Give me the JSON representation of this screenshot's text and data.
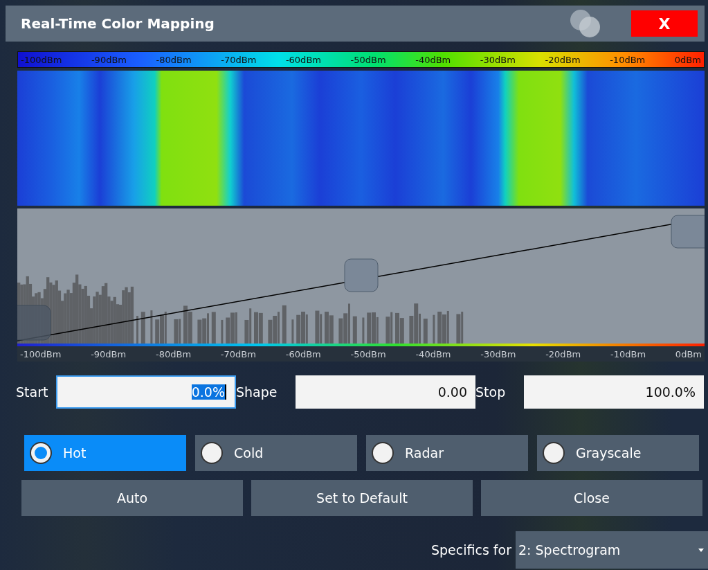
{
  "window": {
    "title": "Real-Time Color Mapping",
    "close_label": "X"
  },
  "top_scale": {
    "labels": [
      "-100dBm",
      "-90dBm",
      "-80dBm",
      "-70dBm",
      "-60dBm",
      "-50dBm",
      "-40dBm",
      "-30dBm",
      "-20dBm",
      "-10dBm",
      "0dBm"
    ]
  },
  "bottom_scale": {
    "labels": [
      "-100dBm",
      "-90dBm",
      "-80dBm",
      "-70dBm",
      "-60dBm",
      "-50dBm",
      "-40dBm",
      "-30dBm",
      "-20dBm",
      "-10dBm",
      "0dBm"
    ]
  },
  "fields": [
    {
      "label": "Start",
      "value": "0.0%",
      "focused": true
    },
    {
      "label": "Shape",
      "value": "0.00",
      "focused": false
    },
    {
      "label": "Stop",
      "value": "100.0%",
      "focused": false
    }
  ],
  "color_schemes": [
    {
      "label": "Hot",
      "selected": true
    },
    {
      "label": "Cold",
      "selected": false
    },
    {
      "label": "Radar",
      "selected": false
    },
    {
      "label": "Grayscale",
      "selected": false
    }
  ],
  "buttons": [
    "Auto",
    "Set to Default",
    "Close"
  ],
  "specifics": {
    "label": "Specifics for",
    "value": "2: Spectrogram"
  }
}
